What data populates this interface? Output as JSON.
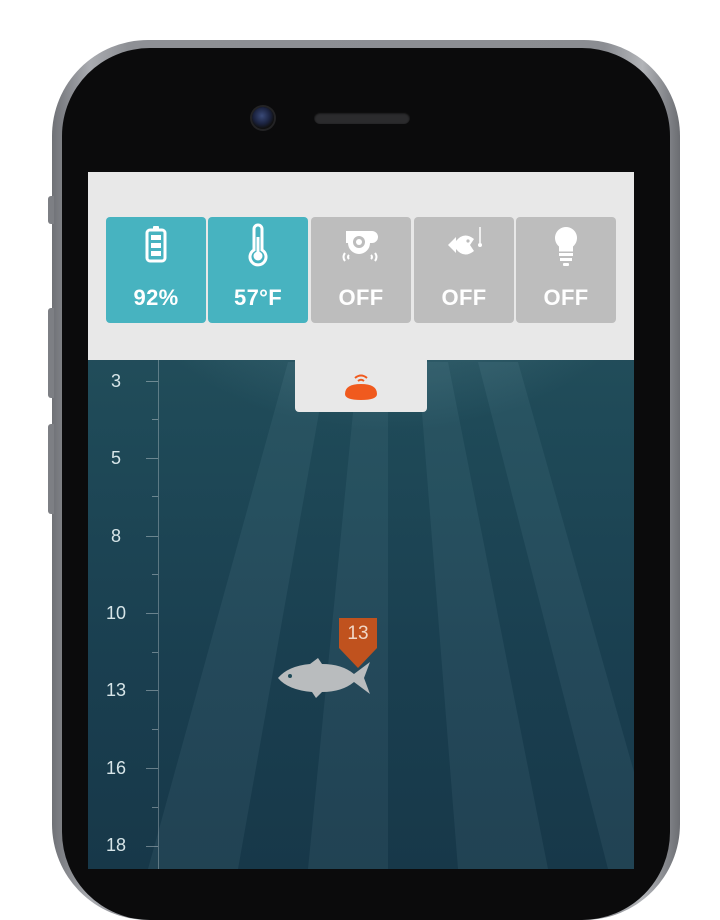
{
  "status": {
    "tiles": [
      {
        "id": "battery",
        "icon": "battery-icon",
        "value": "92%",
        "active": true
      },
      {
        "id": "temperature",
        "icon": "thermometer-icon",
        "value": "57°F",
        "active": true
      },
      {
        "id": "alarm",
        "icon": "alarm-bell-icon",
        "value": "OFF",
        "active": false
      },
      {
        "id": "fish-alarm",
        "icon": "fish-alarm-icon",
        "value": "OFF",
        "active": false
      },
      {
        "id": "light",
        "icon": "light-bulb-icon",
        "value": "OFF",
        "active": false
      }
    ],
    "colors": {
      "active": "#47b3c0",
      "inactive": "#bdbdbd",
      "bar": "#e8e8e8",
      "accent": "#f05a1e"
    }
  },
  "sonar": {
    "device_icon": "sonar-device-icon",
    "depth_scale": [
      "3",
      "5",
      "8",
      "10",
      "13",
      "16",
      "18"
    ],
    "fish": [
      {
        "depth_label": "13",
        "icon": "fish-icon",
        "marker_color": "#c0521e"
      }
    ]
  }
}
